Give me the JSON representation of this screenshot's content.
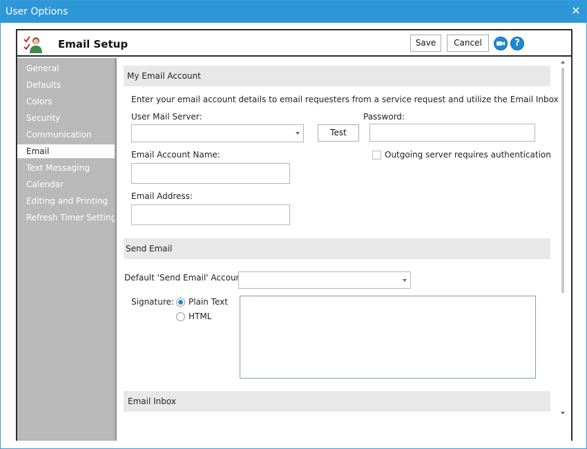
{
  "window": {
    "title": "User Options",
    "close_glyph": "✕"
  },
  "header": {
    "title": "Email Setup",
    "save_label": "Save",
    "cancel_label": "Cancel",
    "help_glyph": "?",
    "icons": [
      "user-check-icon",
      "video-icon",
      "help-icon"
    ]
  },
  "sidebar": {
    "items": [
      {
        "label": "General"
      },
      {
        "label": "Defaults"
      },
      {
        "label": "Colors"
      },
      {
        "label": "Security"
      },
      {
        "label": "Communication"
      },
      {
        "label": "Email",
        "active": true
      },
      {
        "label": "Text Messaging"
      },
      {
        "label": "Calendar"
      },
      {
        "label": "Editing and Printing"
      },
      {
        "label": "Refresh Timer Settings"
      }
    ]
  },
  "my_email_account": {
    "title": "My Email Account",
    "description": "Enter your email account details to email requesters from a service request and utilize the Email Inbox",
    "mail_server_label": "User Mail Server:",
    "mail_server_value": "",
    "test_label": "Test",
    "password_label": "Password:",
    "password_value": "",
    "auth_label": "Outgoing server requires authentication",
    "auth_checked": false,
    "account_name_label": "Email Account Name:",
    "account_name_value": "",
    "email_address_label": "Email Address:",
    "email_address_value": ""
  },
  "send_email": {
    "title": "Send Email",
    "default_account_label": "Default 'Send Email' Account:",
    "default_account_value": "",
    "signature_label": "Signature:",
    "plain_text_label": "Plain Text",
    "html_label": "HTML",
    "selected_format": "Plain Text",
    "signature_value": ""
  },
  "email_inbox": {
    "title": "Email Inbox"
  },
  "colors": {
    "titlebar": "#2d97d8",
    "sidebar": "#b9b9b9",
    "section": "#e8e8e8",
    "accent": "#1e88d6"
  }
}
